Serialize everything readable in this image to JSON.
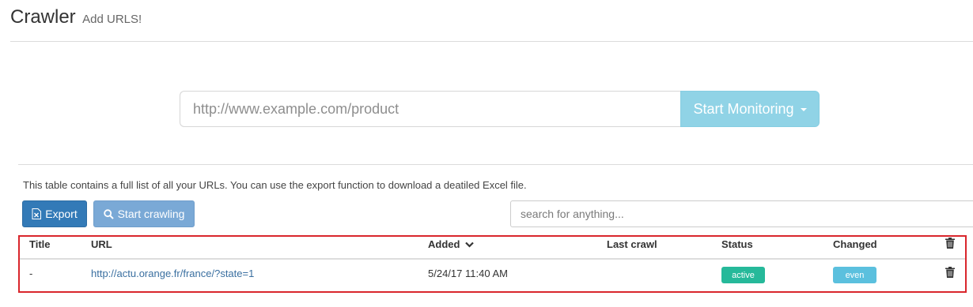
{
  "header": {
    "title": "Crawler",
    "subtitle": "Add URLS!"
  },
  "monitor": {
    "url_placeholder": "http://www.example.com/product",
    "start_button": "Start Monitoring",
    "button_color": "#90d3e6"
  },
  "list": {
    "description": "This table contains a full list of all your URLs. You can use the export function to download a deatiled Excel file.",
    "export_button": "Export",
    "crawl_button": "Start crawling",
    "search_placeholder": "search for anything...",
    "highlight_color": "#d9262c"
  },
  "table": {
    "columns": {
      "title": "Title",
      "url": "URL",
      "added": "Added",
      "last_crawl": "Last crawl",
      "status": "Status",
      "changed": "Changed"
    },
    "rows": [
      {
        "title": "-",
        "url": "http://actu.orange.fr/france/?state=1",
        "added": "5/24/17 11:40 AM",
        "last_crawl": "",
        "status": "active",
        "changed": "even"
      }
    ],
    "status_colors": {
      "active": "#26b99a",
      "even": "#5bc0de"
    }
  },
  "icons": {
    "export": "excel-file-icon",
    "crawl": "search-icon",
    "sort": "chevron-down-icon",
    "delete": "trash-icon"
  }
}
